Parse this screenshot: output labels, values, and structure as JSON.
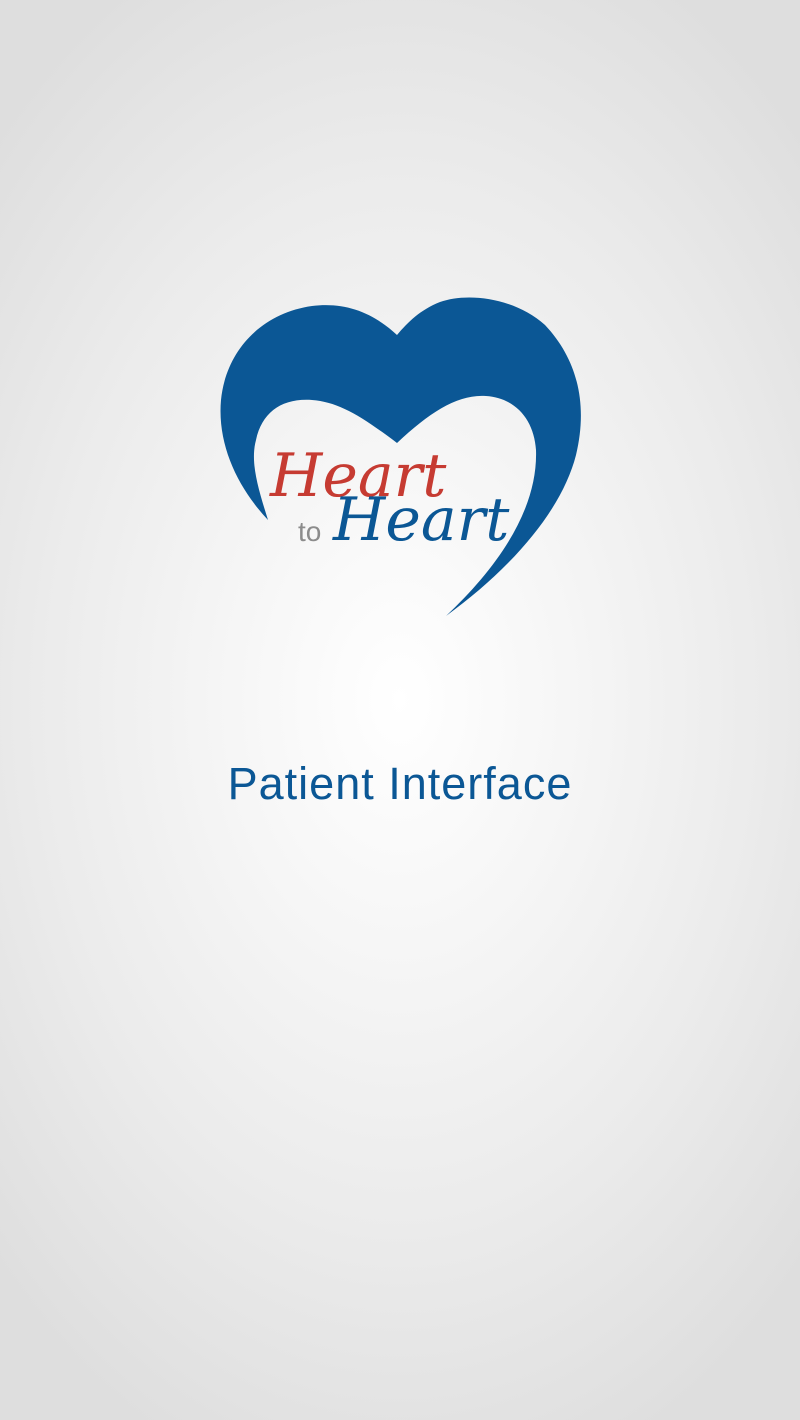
{
  "logo": {
    "word_top": "Heart",
    "word_connector": "to",
    "word_bottom": "Heart"
  },
  "subtitle": "Patient Interface",
  "colors": {
    "brand_blue": "#0b5795",
    "brand_red": "#c63b32",
    "connector_gray": "#8c8c8c"
  }
}
